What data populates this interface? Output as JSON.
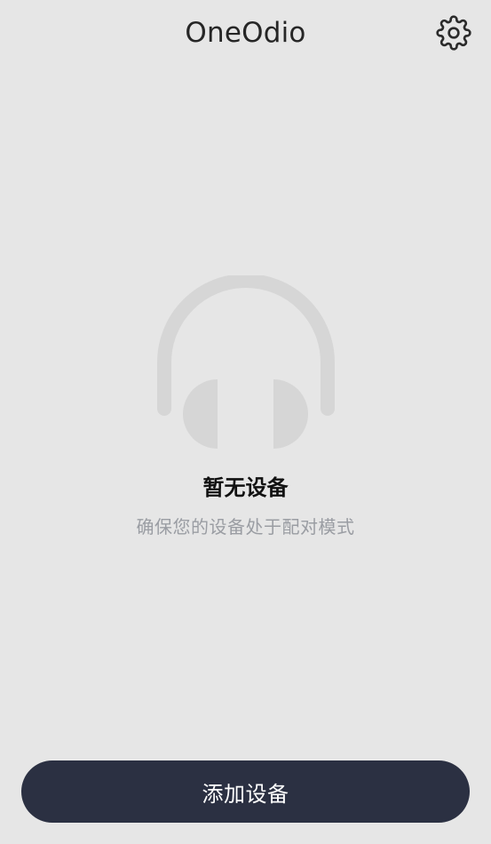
{
  "header": {
    "title": "OneOdio",
    "settings_icon": "gear-icon"
  },
  "empty_state": {
    "icon": "headphones-icon",
    "title": "暂无设备",
    "subtitle": "确保您的设备处于配对模式"
  },
  "footer": {
    "add_button_label": "添加设备"
  },
  "colors": {
    "background": "#e6e6e6",
    "button": "#2b3042",
    "icon_placeholder": "#d6d6d6",
    "subtitle": "#9a9da3"
  }
}
